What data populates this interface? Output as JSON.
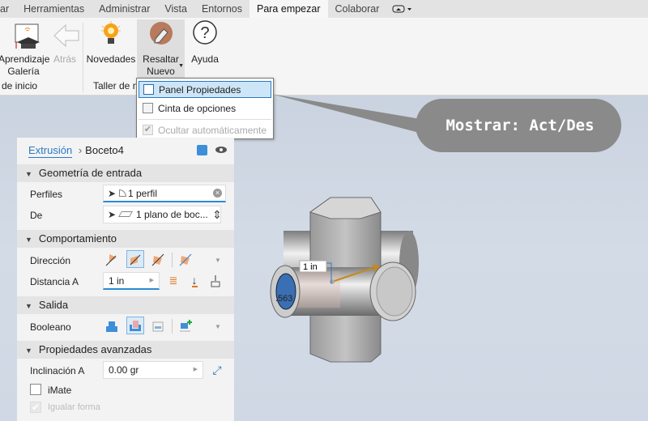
{
  "tabs": [
    "ar",
    "Herramientas",
    "Administrar",
    "Vista",
    "Entornos",
    "Para empezar",
    "Colaborar"
  ],
  "active_tab": "Para empezar",
  "ribbon": {
    "buttons": {
      "learning_gallery": "Aprendizaje\nGalería",
      "learning_l1": "Aprendizaje",
      "learning_l2": "Galería",
      "back": "Atrás",
      "whats_new": "Novedades",
      "highlight_l1": "Resaltar",
      "highlight_l2": "Nuevo",
      "help": "Ayuda"
    },
    "panels": {
      "start": "de inicio",
      "workshop": "Taller de n"
    }
  },
  "menu": {
    "items": [
      {
        "label": "Panel Propiedades",
        "checked": false
      },
      {
        "label": "Cinta de opciones",
        "checked": false
      },
      {
        "label": "Ocultar automáticamente",
        "checked": true,
        "disabled": true
      }
    ]
  },
  "callout": "Mostrar: Act/Des",
  "panel": {
    "breadcrumb_link": "Extrusión",
    "breadcrumb_current": "Boceto4",
    "sections": {
      "input": "Geometría de entrada",
      "behavior": "Comportamiento",
      "output": "Salida",
      "advanced": "Propiedades avanzadas"
    },
    "profiles_label": "Perfiles",
    "profiles_value": "1 perfil",
    "from_label": "De",
    "from_value": "1 plano de boc...",
    "direction_label": "Dirección",
    "distance_label": "Distancia A",
    "distance_value": "1 in",
    "boolean_label": "Booleano",
    "taper_label": "Inclinación A",
    "taper_value": "0.00 gr",
    "imate_label": "iMate",
    "imate_checked": false,
    "match_shape_label": "Igualar forma",
    "match_shape_checked": true
  },
  "viewport": {
    "dimension_label": "1 in",
    "diameter_label": ".563"
  }
}
